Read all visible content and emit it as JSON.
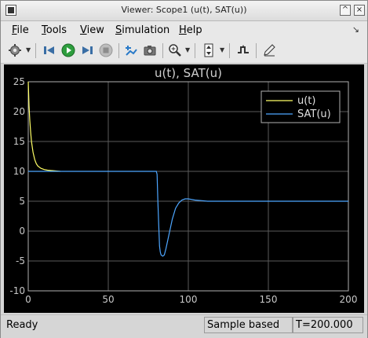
{
  "window": {
    "title": "Viewer: Scope1 (u(t), SAT(u))",
    "minimize": "^",
    "close": "×"
  },
  "menu": {
    "items": [
      {
        "u": "F",
        "rest": "ile"
      },
      {
        "u": "T",
        "rest": "ools"
      },
      {
        "u": "V",
        "rest": "iew"
      },
      {
        "u": "S",
        "rest": "imulation"
      },
      {
        "u": "H",
        "rest": "elp"
      }
    ],
    "pin": "↘"
  },
  "toolbar": {
    "icons": [
      "gear-icon",
      "step-back-icon",
      "run-icon",
      "step-forward-icon",
      "stop-icon",
      "highlight-icon",
      "camera-icon",
      "zoom-icon",
      "autoscale-icon",
      "signal-icon",
      "edit-icon"
    ]
  },
  "status": {
    "ready": "Ready",
    "mode": "Sample based",
    "time": "T=200.000"
  },
  "chart_data": {
    "type": "line",
    "title": "u(t), SAT(u)",
    "xlabel": "",
    "ylabel": "",
    "xlim": [
      0,
      200
    ],
    "ylim": [
      -10,
      25
    ],
    "xticks": [
      0,
      50,
      100,
      150,
      200
    ],
    "yticks": [
      -10,
      -5,
      0,
      5,
      10,
      15,
      20,
      25
    ],
    "grid": true,
    "legend": "top-right",
    "background": "#000000",
    "series": [
      {
        "name": "u(t)",
        "color": "#ffff66",
        "x": [
          0,
          0.5,
          1,
          1.5,
          2,
          3,
          4,
          5,
          6,
          8,
          10,
          12,
          14,
          16,
          18,
          20
        ],
        "y": [
          25,
          21,
          18.5,
          16.5,
          15,
          13.2,
          12,
          11.3,
          10.9,
          10.5,
          10.3,
          10.2,
          10.15,
          10.1,
          10.05,
          10
        ]
      },
      {
        "name": "SAT(u)",
        "color": "#4da6ff",
        "x": [
          0,
          80,
          80.5,
          81,
          81.5,
          82,
          82.5,
          83,
          84,
          85,
          86,
          88,
          90,
          92,
          94,
          96,
          98,
          100,
          102,
          104,
          108,
          112,
          130,
          160,
          200
        ],
        "y": [
          10,
          10,
          9.5,
          5,
          1,
          -2.5,
          -3.5,
          -4,
          -4.2,
          -4,
          -3,
          -0.5,
          2,
          3.8,
          4.7,
          5.2,
          5.4,
          5.4,
          5.3,
          5.2,
          5.1,
          5.0,
          5.0,
          5.0,
          5.0
        ]
      }
    ]
  }
}
